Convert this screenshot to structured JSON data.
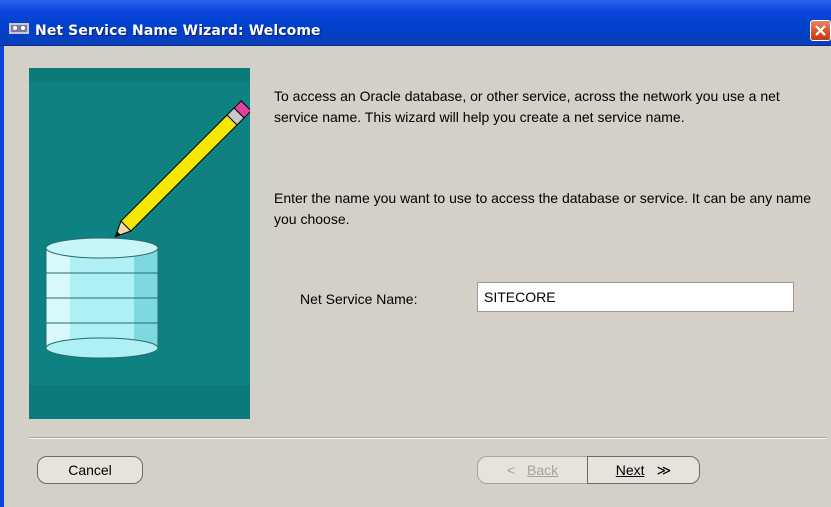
{
  "window": {
    "title": "Net Service Name Wizard: Welcome",
    "close_icon": "close-icon"
  },
  "content": {
    "paragraph1": "To access an Oracle database, or other service, across the network you use a net service name.  This wizard will help you create a net service name.",
    "paragraph2": "Enter the name you want to use to access the database or service.  It can be any name you choose.",
    "field_label": "Net Service Name:",
    "field_value": "SITECORE"
  },
  "buttons": {
    "cancel": "Cancel",
    "back_arrow": "<",
    "back": "Back",
    "next": "Next",
    "next_arrow": "≫"
  },
  "colors": {
    "teal": "#0a7a7a",
    "titlebar": "#0040cc",
    "close": "#d8552e"
  }
}
